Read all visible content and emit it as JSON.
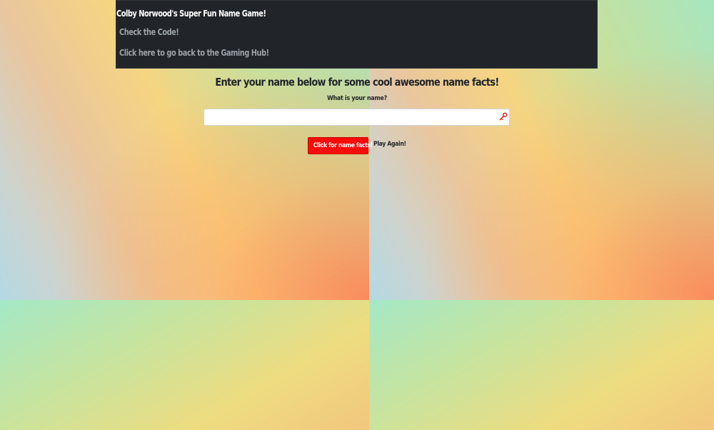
{
  "navbar": {
    "brand": "Colby Norwood's Super Fun Name Game!",
    "links": [
      {
        "label": "Check the Code!"
      },
      {
        "label": "Click here to go back to the Gaming Hub!"
      }
    ]
  },
  "main": {
    "heading": "Enter your name below for some cool awesome name facts!",
    "question_label": "What is your name?",
    "name_input": {
      "value": "",
      "placeholder": "",
      "icon": "key-icon"
    },
    "facts_button_label": "Click for name facts!",
    "play_again_label": "Play Again!"
  },
  "colors": {
    "navbar_bg": "#212529",
    "accent_button": "#ff0a0a",
    "link_color": "#9aa0a6"
  }
}
